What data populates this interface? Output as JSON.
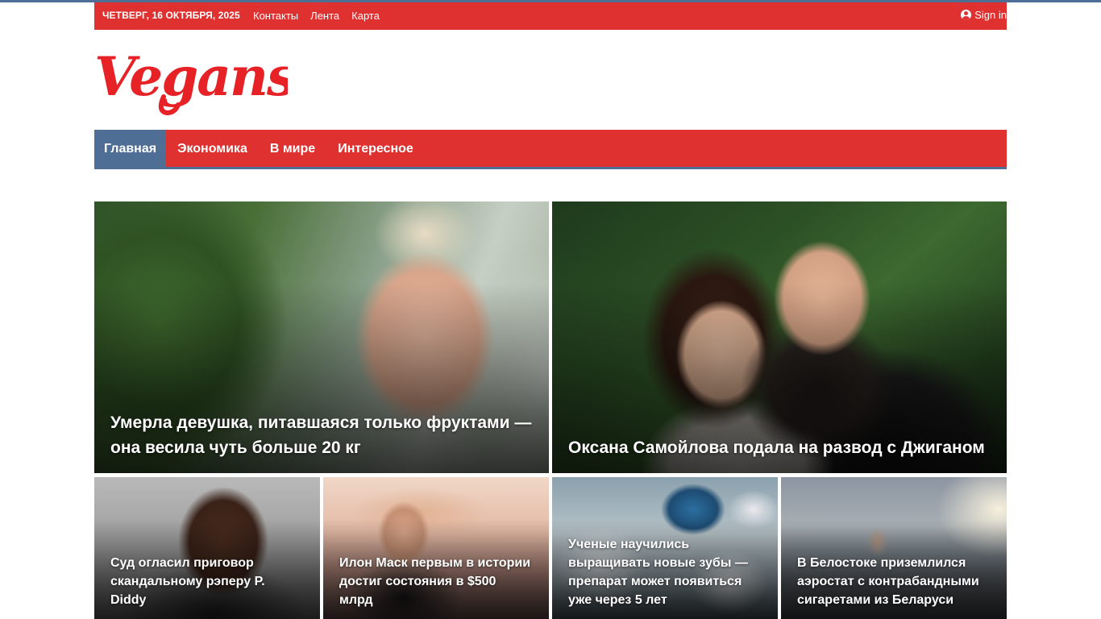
{
  "topbar": {
    "date": "ЧЕТВЕРГ, 16 ОКТЯБРЯ, 2025",
    "links": [
      "Контакты",
      "Лента",
      "Карта"
    ],
    "signin": "Sign in",
    "signin_icon": "user-circle-icon"
  },
  "logo": {
    "text": "Vegans"
  },
  "nav": {
    "items": [
      "Главная",
      "Экономика",
      "В мире",
      "Интересное"
    ],
    "active": "Главная"
  },
  "featured": [
    {
      "title": "Умерла девушка, питавшаяся только фруктами — она весила чуть больше 20 кг"
    },
    {
      "title": "Оксана Самойлова подала на развод с Джиганом"
    }
  ],
  "articles": [
    {
      "title": "Суд огласил приговор скандальному рэперу P. Diddy"
    },
    {
      "title": "Илон Маск первым в истории достиг состояния в $500 млрд"
    },
    {
      "title": "Ученые научились выращивать новые зубы — препарат может появиться уже через 5 лет"
    },
    {
      "title": "В Белостоке приземлился аэростат с контрабандными сигаретами из Беларуси"
    }
  ],
  "colors": {
    "brand_red": "#e03131",
    "accent_blue": "#4f6e96"
  }
}
